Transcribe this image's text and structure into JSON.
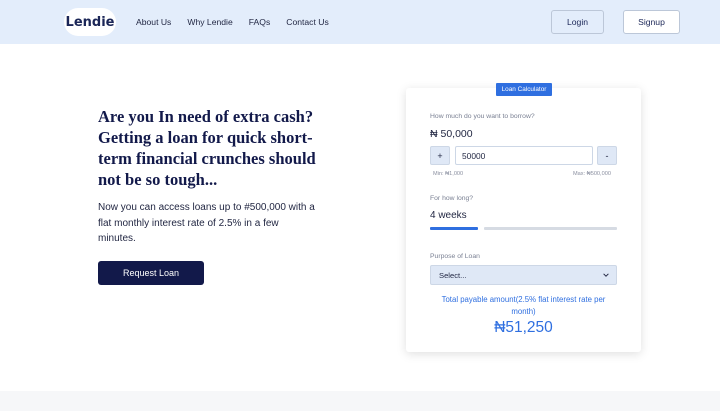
{
  "header": {
    "logo": "Lendie",
    "nav": [
      {
        "label": "About Us"
      },
      {
        "label": "Why Lendie"
      },
      {
        "label": "FAQs"
      },
      {
        "label": "Contact Us"
      }
    ],
    "login_label": "Login",
    "signup_label": "Signup"
  },
  "hero": {
    "title": "Are you In need of extra cash? Getting a loan for quick short-term financial crunches should not be so tough...",
    "description": "Now you can access loans up to #500,000 with a flat monthly interest rate of 2.5% in a few minutes.",
    "cta_label": "Request Loan"
  },
  "calculator": {
    "badge": "Loan Calculator",
    "amount_question": "How much do you want to borrow?",
    "amount_display": "₦ 50,000",
    "increment_label": "+",
    "decrement_label": "-",
    "amount_value": "50000",
    "min_label": "Min: ₦1,000",
    "max_label": "Max: ₦500,000",
    "duration_question": "For how long?",
    "duration_value": "4 weeks",
    "purpose_label": "Purpose of Loan",
    "purpose_selected": "Select...",
    "total_label": "Total payable amount(2.5% flat interest rate per month)",
    "total_value": "₦51,250"
  },
  "colors": {
    "header_bg": "#e3edfb",
    "brand_navy": "#12194a",
    "accent_blue": "#2f6fe0"
  },
  "icons": {
    "select_chevron": "chevron-down-icon"
  }
}
